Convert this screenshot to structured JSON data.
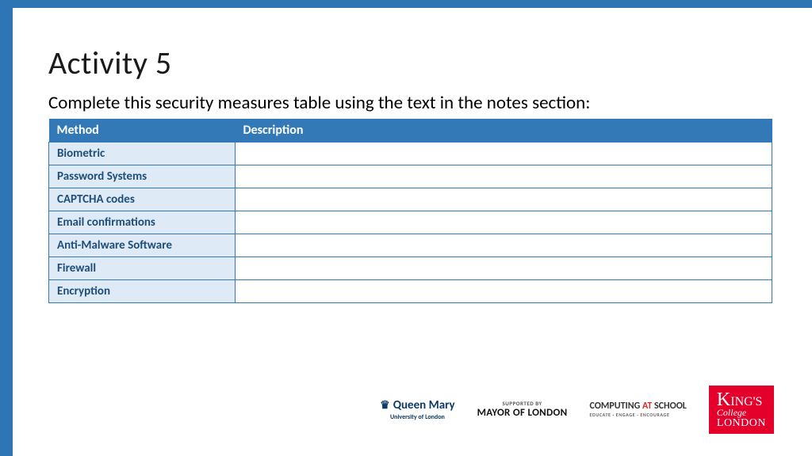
{
  "title": "Activity 5",
  "instruction": "Complete this security measures table using the text in the notes section:",
  "table": {
    "headers": [
      "Method",
      "Description"
    ],
    "rows": [
      {
        "method": "Biometric",
        "description": ""
      },
      {
        "method": "Password Systems",
        "description": ""
      },
      {
        "method": "CAPTCHA codes",
        "description": ""
      },
      {
        "method": "Email confirmations",
        "description": ""
      },
      {
        "method": "Anti-Malware Software",
        "description": ""
      },
      {
        "method": "Firewall",
        "description": ""
      },
      {
        "method": "Encryption",
        "description": ""
      }
    ]
  },
  "footer": {
    "qm": {
      "main": "Queen Mary",
      "sub": "University of London"
    },
    "mayor": {
      "sup": "SUPPORTED BY",
      "main": "MAYOR OF LONDON"
    },
    "cas": {
      "w1": "COMPUTING ",
      "w2": "AT ",
      "w3": "SCHOOL",
      "sub": "EDUCATE · ENGAGE · ENCOURAGE"
    },
    "kcl": {
      "l1a": "K",
      "l1b": "ING'S",
      "l2": "College",
      "l3": "LONDON"
    }
  }
}
